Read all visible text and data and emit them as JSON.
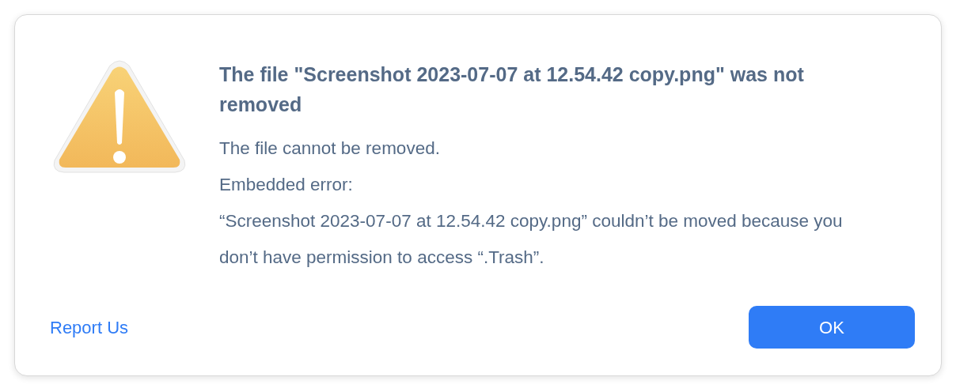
{
  "dialog": {
    "title": "The file \"Screenshot 2023-07-07 at 12.54.42 copy.png\" was not removed",
    "messages": [
      "The file cannot be removed.",
      "Embedded error:",
      "“Screenshot 2023-07-07 at 12.54.42 copy.png” couldn’t be moved because you don’t have permission to access “.Trash”."
    ],
    "link": "Report Us",
    "button": "OK"
  }
}
